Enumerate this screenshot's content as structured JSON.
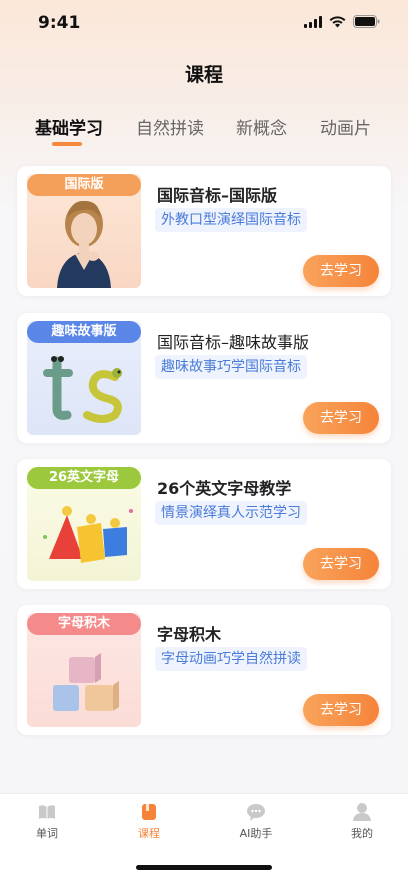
{
  "status_bar": {
    "time": "9:41"
  },
  "header": {
    "title": "课程"
  },
  "tabs": [
    {
      "label": "基础学习",
      "active": true
    },
    {
      "label": "自然拼读",
      "active": false
    },
    {
      "label": "新概念",
      "active": false
    },
    {
      "label": "动画片",
      "active": false
    }
  ],
  "courses": [
    {
      "badge": "国际版",
      "badge_color": "#f5a05a",
      "title": "国际音标–国际版",
      "tag": "外教口型演绎国际音标",
      "button": "去学习"
    },
    {
      "badge": "趣味故事版",
      "badge_color": "#5a86e8",
      "title": "国际音标–趣味故事版",
      "tag": "趣味故事巧学国际音标",
      "button": "去学习"
    },
    {
      "badge": "26英文字母",
      "badge_color": "#9bc83c",
      "title": "26个英文字母教学",
      "tag": "情景演绎真人示范学习",
      "button": "去学习"
    },
    {
      "badge": "字母积木",
      "badge_color": "#f58a8a",
      "title": "字母积木",
      "tag": "字母动画巧学自然拼读",
      "button": "去学习"
    }
  ],
  "tabbar": [
    {
      "label": "单词",
      "icon": "book-icon",
      "active": false
    },
    {
      "label": "课程",
      "icon": "course-icon",
      "active": true
    },
    {
      "label": "AI助手",
      "icon": "chat-icon",
      "active": false
    },
    {
      "label": "我的",
      "icon": "profile-icon",
      "active": false
    }
  ],
  "colors": {
    "accent": "#f5843a",
    "tag_text": "#4a7bd8",
    "tag_bg": "#eef3fd"
  }
}
